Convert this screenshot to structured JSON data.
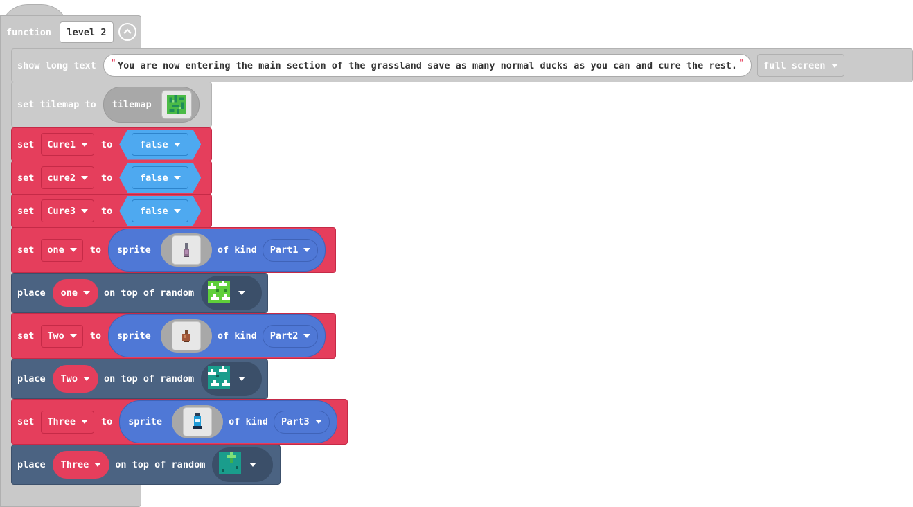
{
  "function_block": {
    "keyword": "function",
    "name": "level 2"
  },
  "blocks": {
    "show_text": {
      "keyword": "show long text",
      "text": "You are now entering the main section of the grassland save as many normal ducks as you can and cure the rest.",
      "mode": "full screen"
    },
    "set_tilemap": {
      "keyword": "set tilemap to",
      "reporter": "tilemap"
    },
    "set_cure1": {
      "kw_set": "set",
      "var": "Cure1",
      "kw_to": "to",
      "value": "false"
    },
    "set_cure2": {
      "kw_set": "set",
      "var": "cure2",
      "kw_to": "to",
      "value": "false"
    },
    "set_cure3": {
      "kw_set": "set",
      "var": "Cure3",
      "kw_to": "to",
      "value": "false"
    },
    "set_one": {
      "kw_set": "set",
      "var": "one",
      "kw_to": "to",
      "kw_sprite": "sprite",
      "kw_kind": "of kind",
      "kind": "Part1"
    },
    "place_one": {
      "kw_place": "place",
      "var": "one",
      "kw_on": "on top of random"
    },
    "set_two": {
      "kw_set": "set",
      "var": "Two",
      "kw_to": "to",
      "kw_sprite": "sprite",
      "kw_kind": "of kind",
      "kind": "Part2"
    },
    "place_two": {
      "kw_place": "place",
      "var": "Two",
      "kw_on": "on top of random"
    },
    "set_three": {
      "kw_set": "set",
      "var": "Three",
      "kw_to": "to",
      "kw_sprite": "sprite",
      "kw_kind": "of kind",
      "kind": "Part3"
    },
    "place_three": {
      "kw_place": "place",
      "var": "Three",
      "kw_on": "on top of random"
    }
  },
  "colors": {
    "function_gray": "#c9c9c9",
    "variables_red": "#e53e5c",
    "logic_blue": "#4ea9f0",
    "sprites_blue": "#4f78d6",
    "scene_dark": "#4b6382"
  },
  "icons": {
    "collapse": "chevron-up-circle-icon",
    "tilemap": "tilemap-thumbnail-icon",
    "sprite_part1": "vase-sprite-icon",
    "sprite_part2": "pot-sprite-icon",
    "sprite_part3": "bottle-sprite-icon",
    "tile_grass_flowers": "grass-flower-tile-icon",
    "tile_teal_flowers": "teal-flower-tile-icon",
    "tile_teal_sprout": "teal-sprout-tile-icon"
  }
}
